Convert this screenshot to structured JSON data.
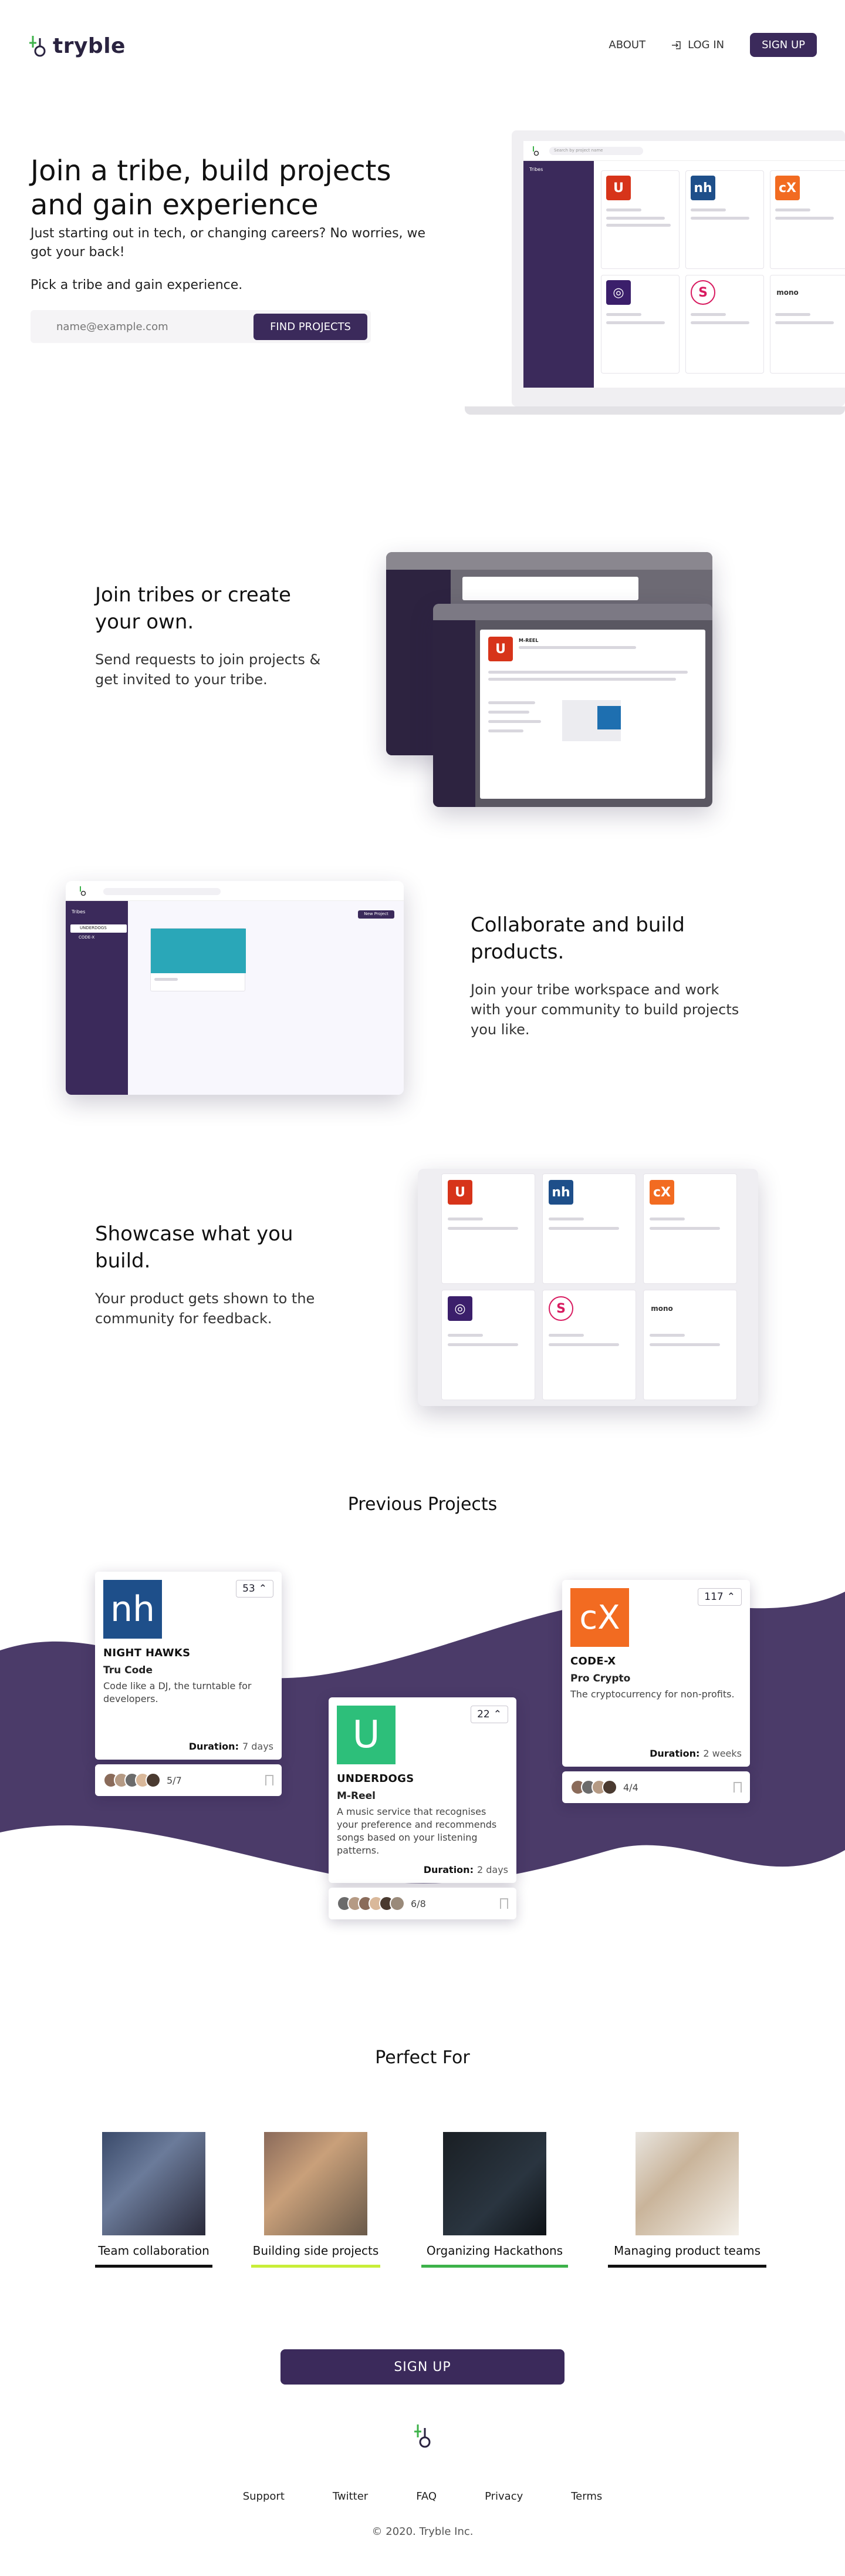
{
  "header": {
    "brand": "tryble",
    "nav": {
      "about": "ABOUT",
      "login": "LOG IN",
      "signup": "SIGN UP"
    }
  },
  "hero": {
    "title": "Join a tribe, build projects and gain experience",
    "lead": "Just starting out in tech, or changing careers?  No worries, we got your back!",
    "pick": "Pick a tribe and gain experience.",
    "email_placeholder": "name@example.com",
    "cta": "FIND PROJECTS"
  },
  "mock": {
    "search_placeholder": "Search by project name",
    "sidebar_item": "Tribes"
  },
  "section_join": {
    "title": "Join tribes or create your own.",
    "text": "Send requests to join projects & get invited to your tribe."
  },
  "section_collab": {
    "title": "Collaborate and build products.",
    "text": "Join your tribe workspace and work with your community to build projects you like.",
    "new_project": "New Project",
    "tribe_underdogs": "UNDERDOGS",
    "tribe_codex": "CODE-X"
  },
  "section_showcase": {
    "title": "Showcase what you build.",
    "text": "Your product gets shown to the community for feedback."
  },
  "previous": {
    "title": "Previous Projects",
    "projects": [
      {
        "team": "NIGHT HAWKS",
        "name": "Tru Code",
        "desc": "Code like a DJ, the turntable for developers.",
        "votes": "53",
        "duration_label": "Duration:",
        "duration": "7 days",
        "members": "5/7",
        "logo_color": "#1e4f8a",
        "logo_text": "nh"
      },
      {
        "team": "UNDERDOGS",
        "name": "M-Reel",
        "desc": "A music service that recognises your preference and recommends songs based on your listening patterns.",
        "votes": "22",
        "duration_label": "Duration:",
        "duration": "2 days",
        "members": "6/8",
        "logo_color": "#2dbf7a",
        "logo_text": "U"
      },
      {
        "team": "CODE-X",
        "name": "Pro Crypto",
        "desc": "The cryptocurrency for non-profits.",
        "votes": "117",
        "duration_label": "Duration:",
        "duration": "2 weeks",
        "members": "4/4",
        "logo_color": "#f26b21",
        "logo_text": "cX"
      }
    ]
  },
  "perfect_for": {
    "title": "Perfect For",
    "items": [
      {
        "label": "Team collaboration",
        "bar_color": "#111111"
      },
      {
        "label": "Building side projects",
        "bar_color": "#c8ee38"
      },
      {
        "label": "Organizing Hackathons",
        "bar_color": "#3db24a"
      },
      {
        "label": "Managing product teams",
        "bar_color": "#111111"
      }
    ]
  },
  "signup_cta": "SIGN UP",
  "footer": {
    "links": [
      "Support",
      "Twitter",
      "FAQ",
      "Privacy",
      "Terms"
    ],
    "copyright": "© 2020. Tryble Inc."
  }
}
